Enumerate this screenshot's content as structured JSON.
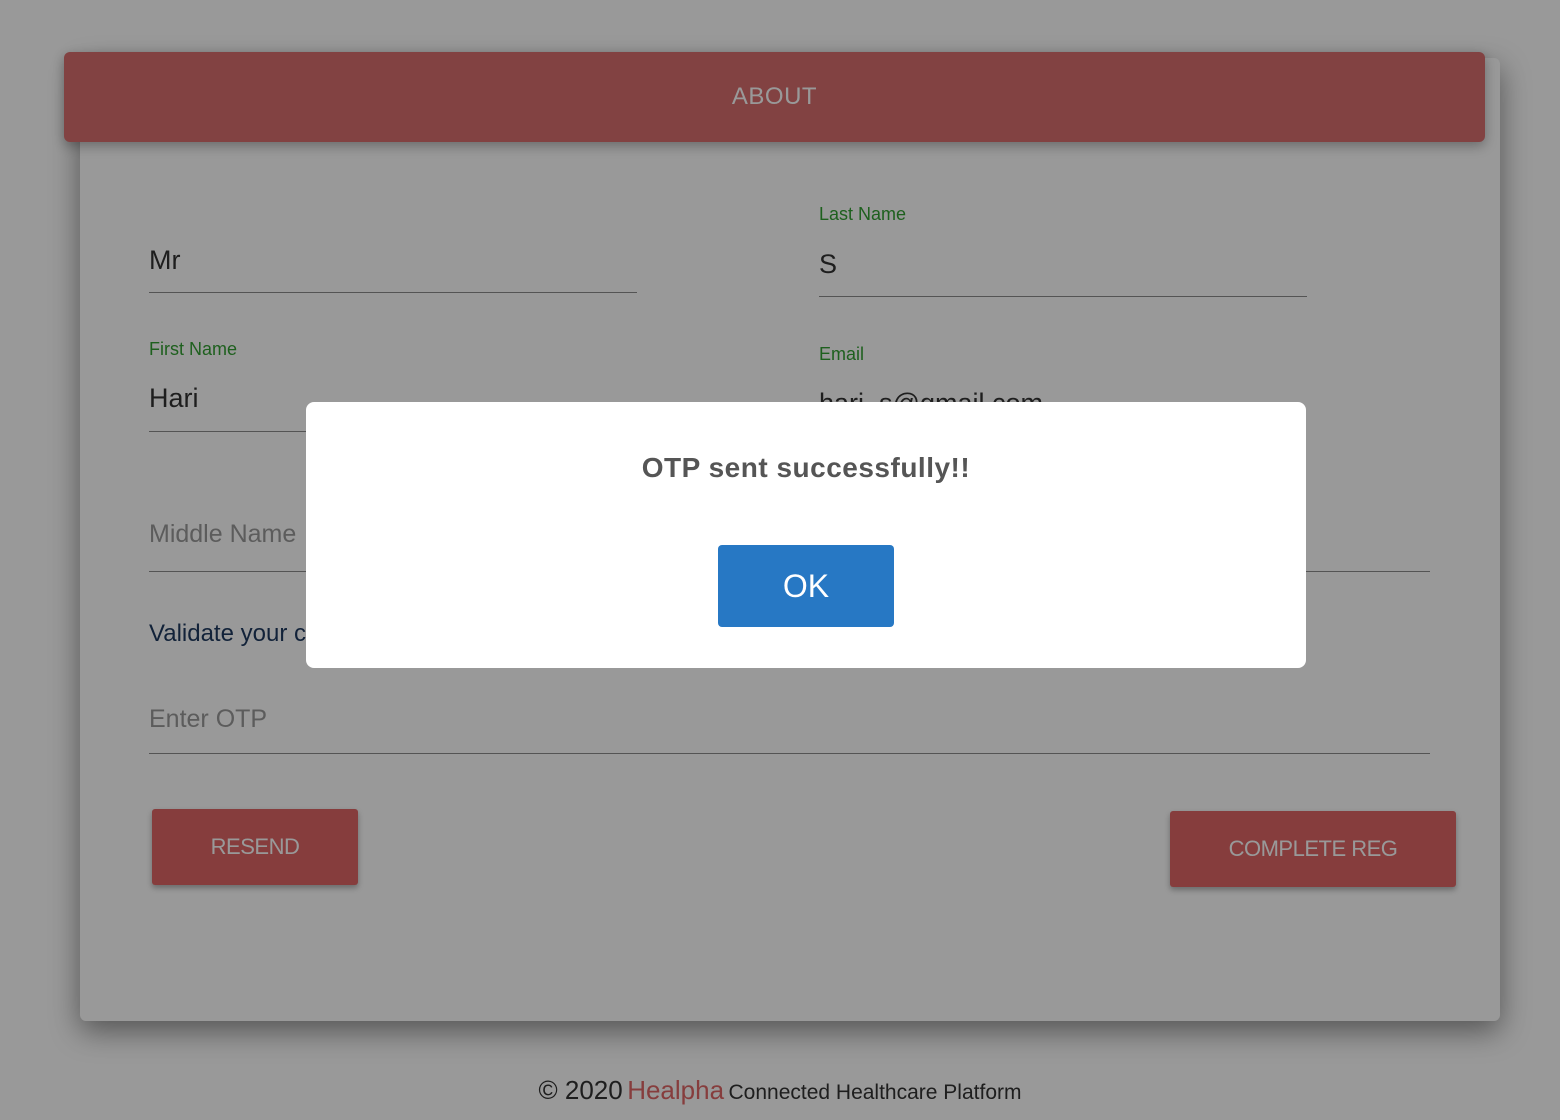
{
  "header": {
    "title": "ABOUT"
  },
  "form": {
    "salutation": {
      "value": "Mr"
    },
    "last_name": {
      "label": "Last Name",
      "value": "S"
    },
    "first_name": {
      "label": "First Name",
      "value": "Hari"
    },
    "email": {
      "label": "Email",
      "value": "hari_s@gmail.com"
    },
    "middle_name": {
      "placeholder": "Middle Name"
    },
    "validate_text": "Validate your c",
    "otp": {
      "placeholder": "Enter OTP"
    }
  },
  "buttons": {
    "resend": "RESEND",
    "complete": "COMPLETE REG"
  },
  "footer": {
    "copyright": "© 2020",
    "brand": "Healpha",
    "tagline": "Connected Healthcare Platform"
  },
  "modal": {
    "message": "OTP sent successfully!!",
    "ok_label": "OK"
  },
  "colors": {
    "accent": "#e06666",
    "label_green": "#33a033",
    "ok_blue": "#2778c4"
  }
}
